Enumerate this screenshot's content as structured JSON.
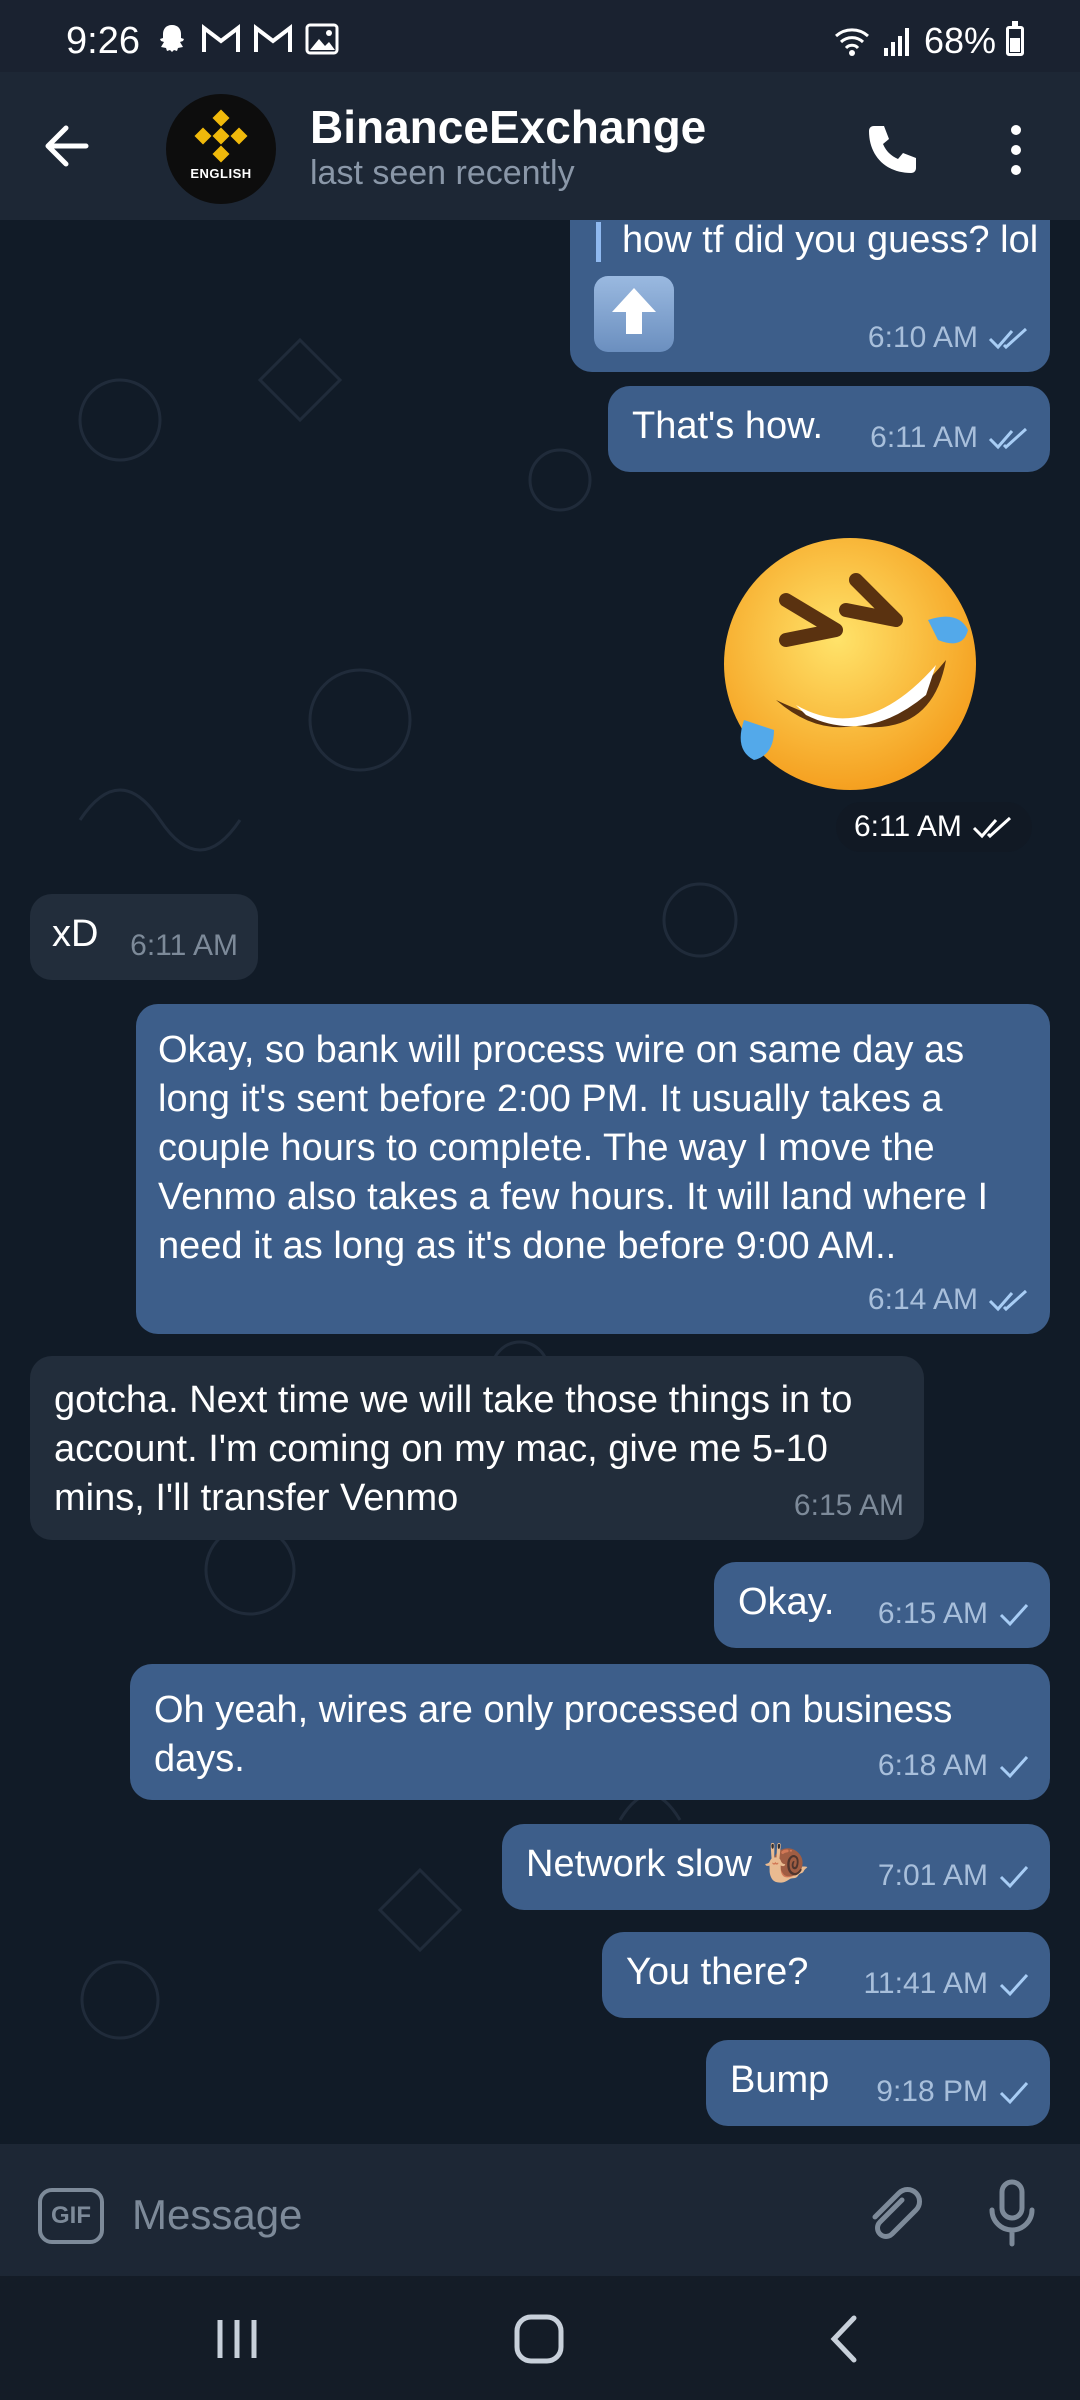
{
  "status_bar": {
    "time": "9:26",
    "battery": "68%",
    "notif_icons": [
      "snapchat-icon",
      "gmail-icon",
      "gmail-icon",
      "gallery-icon"
    ]
  },
  "header": {
    "title": "BinanceExchange",
    "subtitle": "last seen recently",
    "avatar_text": "ENGLISH"
  },
  "messages": [
    {
      "id": "m1",
      "dir": "out",
      "text": "how tf did you guess? lol",
      "time": "6:10 AM",
      "status": "read"
    },
    {
      "id": "m2",
      "dir": "out",
      "text": "That's how.",
      "time": "6:11 AM",
      "status": "read"
    },
    {
      "id": "m3",
      "dir": "out",
      "type": "sticker",
      "time": "6:11 AM",
      "status": "read"
    },
    {
      "id": "m4",
      "dir": "in",
      "text": "xD",
      "time": "6:11 AM"
    },
    {
      "id": "m5",
      "dir": "out",
      "text": "Okay, so bank will process wire on same day as long it's sent before 2:00 PM. It usually takes a couple hours to complete. The way I move the Venmo also takes a few hours. It will land where I need it as long as it's done before 9:00 AM..",
      "time": "6:14 AM",
      "status": "read"
    },
    {
      "id": "m6",
      "dir": "in",
      "text": "gotcha. Next time we will take those things in to account. I'm coming on my mac, give me 5-10 mins, I'll transfer Venmo",
      "time": "6:15 AM"
    },
    {
      "id": "m7",
      "dir": "out",
      "text": "Okay.",
      "time": "6:15 AM",
      "status": "sent"
    },
    {
      "id": "m8",
      "dir": "out",
      "text": "Oh yeah, wires are only processed on business days.",
      "time": "6:18 AM",
      "status": "sent"
    },
    {
      "id": "m9",
      "dir": "out",
      "text": "Network slow 🐌",
      "time": "7:01 AM",
      "status": "sent"
    },
    {
      "id": "m10",
      "dir": "out",
      "text": "You there?",
      "time": "11:41 AM",
      "status": "sent"
    },
    {
      "id": "m11",
      "dir": "out",
      "text": "Bump",
      "time": "9:18 PM",
      "status": "sent"
    }
  ],
  "composer": {
    "placeholder": "Message",
    "gif_label": "GIF"
  },
  "colors": {
    "outgoing_bubble": "#3d5e8a",
    "incoming_bubble": "#222d3b",
    "background": "#111b27",
    "header": "#1d2735"
  }
}
